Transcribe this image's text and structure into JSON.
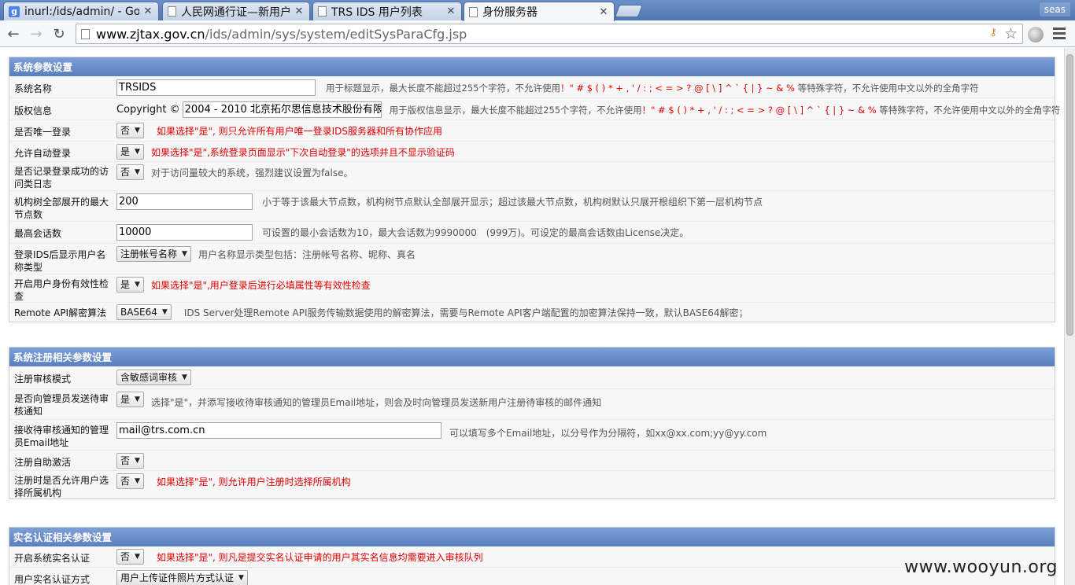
{
  "browser": {
    "tabs": [
      {
        "title": "inurl:/ids/admin/ - Go",
        "icon": "google-icon",
        "active": false
      },
      {
        "title": "人民网通行证—新用户",
        "icon": "page-icon",
        "active": false
      },
      {
        "title": "TRS IDS 用户列表",
        "icon": "page-icon",
        "active": false
      },
      {
        "title": "身份服务器",
        "icon": "page-icon",
        "active": true
      }
    ],
    "tab_close": "✕",
    "profile": "seas",
    "url_host": "www.zjtax.gov.cn",
    "url_path": "/ids/admin/sys/system/editSysParaCfg.jsp"
  },
  "sections": [
    {
      "title": "系统参数设置",
      "rows": [
        {
          "label": "系统名称",
          "control": "input",
          "value": "TRSIDS",
          "hint": "用于标题显示，最大长度不能超过255个字符，不允许使用！\" # $ ( ) * + , ' / : ; < = > ? @ [ \\ ] ^ ` { | } ~ & % 等特殊字符，不允许使用中文以外的全角字符",
          "hint_red": "！\" # $ ( ) * + , ' / : ; < = > ? @ [ \\ ] ^ ` { | } ~ & %"
        },
        {
          "label": "版权信息",
          "control": "copyright",
          "prefix": "Copyright ©",
          "value": "2004 - 2010 北京拓尔思信息技术股份有限",
          "hint": "用于版权信息显示，最大长度不能超过255个字符，不允许使用！\" # $ ( ) * + , ' / : ; < = > ? @ [ \\ ] ^ ` { | } ~ & % 等特殊字符，不允许使用中文以外的全角字符"
        },
        {
          "label": "是否唯一登录",
          "control": "select",
          "value": "否",
          "hint": "如果选择\"是\", 则只允许所有用户唯一登录IDS服务器和所有协作应用",
          "red": true
        },
        {
          "label": "允许自动登录",
          "control": "select",
          "value": "是",
          "hint": "如果选择\"是\",系统登录页面显示\"下次自动登录\"的选项并且不显示验证码",
          "red": true
        },
        {
          "label": "是否记录登录成功的访问类日志",
          "control": "select",
          "value": "否",
          "hint": "对于访问量较大的系统，强烈建议设置为false。"
        },
        {
          "label": "机构树全部展开的最大节点数",
          "control": "input",
          "value": "200",
          "hint": "小于等于该最大节点数，机构树节点默认全部展开显示；超过该最大节点数，机构树默认只展开根组织下第一层机构节点"
        },
        {
          "label": "最高会话数",
          "control": "input",
          "value": "10000",
          "hint": "可设置的最小会话数为10，最大会话数为9990000　(999万)。可设定的最高会话数由License决定。"
        },
        {
          "label": "登录IDS后显示用户名称类型",
          "control": "select",
          "value": "注册帐号名称",
          "hint": "用户名称显示类型包括：注册帐号名称、昵称、真名"
        },
        {
          "label": "开启用户身份有效性检查",
          "control": "select",
          "value": "是",
          "hint": "如果选择\"是\",用户登录后进行必填属性等有效性检查",
          "red": true
        },
        {
          "label": "Remote API解密算法",
          "control": "select",
          "value": "BASE64",
          "hint": "IDS Server处理Remote API服务传输数据使用的解密算法，需要与Remote API客户端配置的加密算法保持一致，默认BASE64解密；"
        }
      ]
    },
    {
      "title": "系统注册相关参数设置",
      "rows": [
        {
          "label": "注册审核模式",
          "control": "select",
          "value": "含敏感词审核",
          "hint": ""
        },
        {
          "label": "是否向管理员发送待审核通知",
          "control": "select",
          "value": "是",
          "hint": "选择\"是\"，并添写接收待审核通知的管理员Email地址，则会及时向管理员发送新用户注册待审核的邮件通知"
        },
        {
          "label": "接收待审核通知的管理员Email地址",
          "control": "input",
          "value": "mail@trs.com.cn",
          "hint": "可以填写多个Email地址，以分号作为分隔符，如xx@xx.com;yy@yy.com"
        },
        {
          "label": "注册自助激活",
          "control": "select",
          "value": "否",
          "hint": ""
        },
        {
          "label": "注册时是否允许用户选择所属机构",
          "control": "select",
          "value": "否",
          "hint": "如果选择\"是\", 则允许用户注册时选择所属机构",
          "red": true
        }
      ]
    },
    {
      "title": "实名认证相关参数设置",
      "rows": [
        {
          "label": "开启系统实名认证",
          "control": "select",
          "value": "否",
          "hint": "如果选择\"是\", 则凡是提交实名认证申请的用户其实名信息均需要进入审核队列",
          "red": true
        },
        {
          "label": "用户实名认证方式",
          "control": "select",
          "value": "用户上传证件照片方式认证",
          "hint": ""
        }
      ]
    }
  ],
  "watermark": "www.wooyun.org",
  "colors": {
    "section_header": "#6a8cc9",
    "warning_text": "#e00000",
    "tabstrip": "#5c82bd"
  }
}
